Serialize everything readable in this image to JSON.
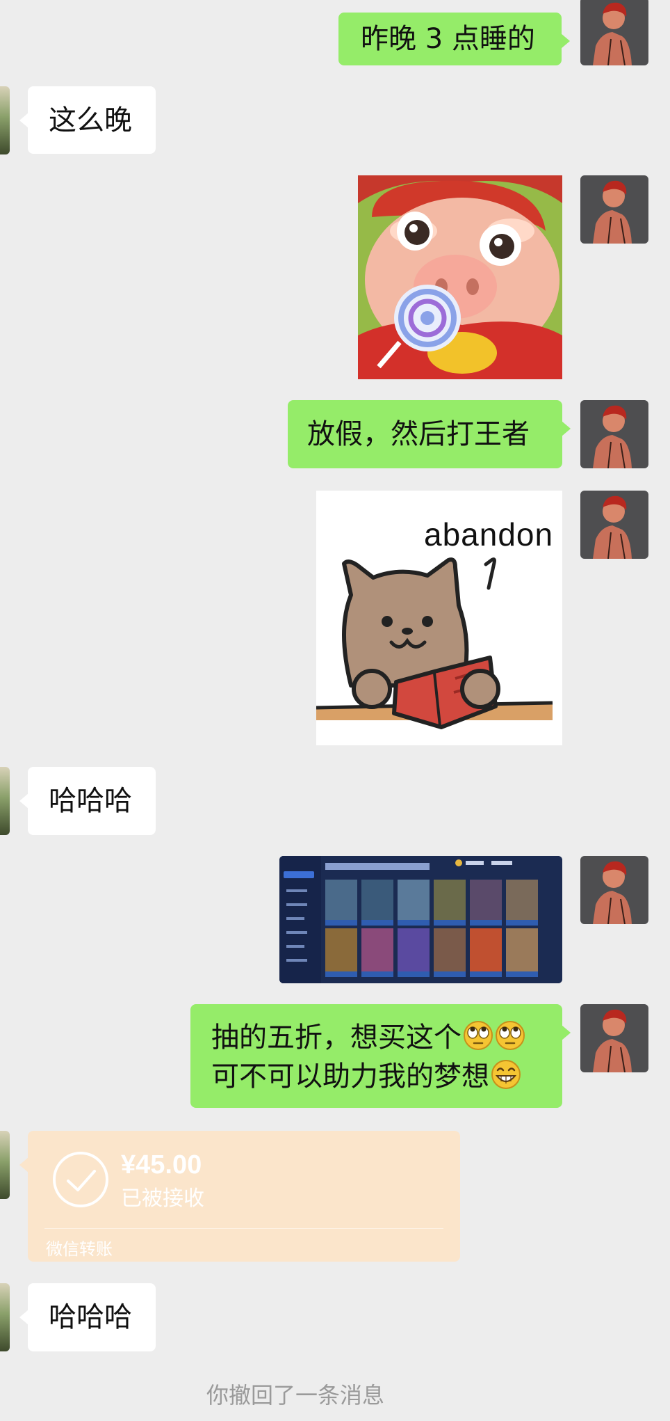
{
  "messages": {
    "m1_text": "昨晚 3 点睡的",
    "m2_text": "这么晚",
    "m4_text": "放假，然后打王者",
    "m5_sticker_caption": "abandon",
    "m6_text": "哈哈哈",
    "m8_line1": "抽的五折，想买这个",
    "m8_line2": "可不可以助力我的梦想",
    "m10_text": "哈哈哈"
  },
  "transfer": {
    "amount": "¥45.00",
    "status": "已被接收",
    "footer": "微信转账"
  },
  "system": {
    "recall_notice": "你撤回了一条消息"
  },
  "colors": {
    "background": "#ededed",
    "my_bubble": "#95ec69",
    "their_bubble": "#ffffff",
    "transfer_card": "#fbe5cb"
  },
  "icons": [
    "avatar-me",
    "avatar-friend",
    "check-circle-icon",
    "rolling-eyes-emoji",
    "grin-emoji"
  ]
}
